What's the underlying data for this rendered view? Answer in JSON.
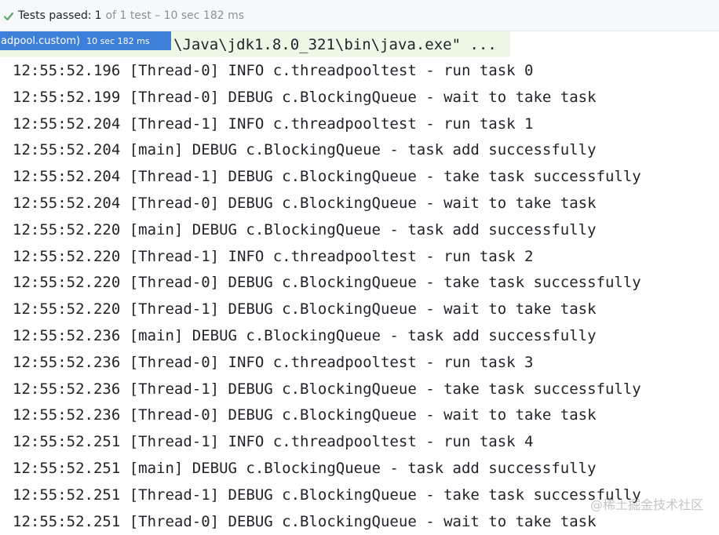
{
  "status": {
    "label": "Tests passed:",
    "count": "1",
    "rest": "of 1 test – 10 sec 182 ms",
    "accent": "#59a869"
  },
  "run_chip": {
    "name": "adpool.custom)",
    "time": "10 sec 182 ms",
    "color": "#3d7fd9"
  },
  "command": {
    "text": "\\Java\\jdk1.8.0_321\\bin\\java.exe\" ..."
  },
  "log_lines": [
    "12:55:52.196 [Thread-0] INFO c.threadpooltest - run task 0",
    "12:55:52.199 [Thread-0] DEBUG c.BlockingQueue - wait to take task",
    "12:55:52.204 [Thread-1] INFO c.threadpooltest - run task 1",
    "12:55:52.204 [main] DEBUG c.BlockingQueue - task add successfully",
    "12:55:52.204 [Thread-1] DEBUG c.BlockingQueue - take task successfully",
    "12:55:52.204 [Thread-0] DEBUG c.BlockingQueue - wait to take task",
    "12:55:52.220 [main] DEBUG c.BlockingQueue - task add successfully",
    "12:55:52.220 [Thread-1] INFO c.threadpooltest - run task 2",
    "12:55:52.220 [Thread-0] DEBUG c.BlockingQueue - take task successfully",
    "12:55:52.220 [Thread-1] DEBUG c.BlockingQueue - wait to take task",
    "12:55:52.236 [main] DEBUG c.BlockingQueue - task add successfully",
    "12:55:52.236 [Thread-0] INFO c.threadpooltest - run task 3",
    "12:55:52.236 [Thread-1] DEBUG c.BlockingQueue - take task successfully",
    "12:55:52.236 [Thread-0] DEBUG c.BlockingQueue - wait to take task",
    "12:55:52.251 [Thread-1] INFO c.threadpooltest - run task 4",
    "12:55:52.251 [main] DEBUG c.BlockingQueue - task add successfully",
    "12:55:52.251 [Thread-1] DEBUG c.BlockingQueue - take task successfully",
    "12:55:52.251 [Thread-0] DEBUG c.BlockingQueue - wait to take task"
  ],
  "watermark": "@稀土掘金技术社区"
}
